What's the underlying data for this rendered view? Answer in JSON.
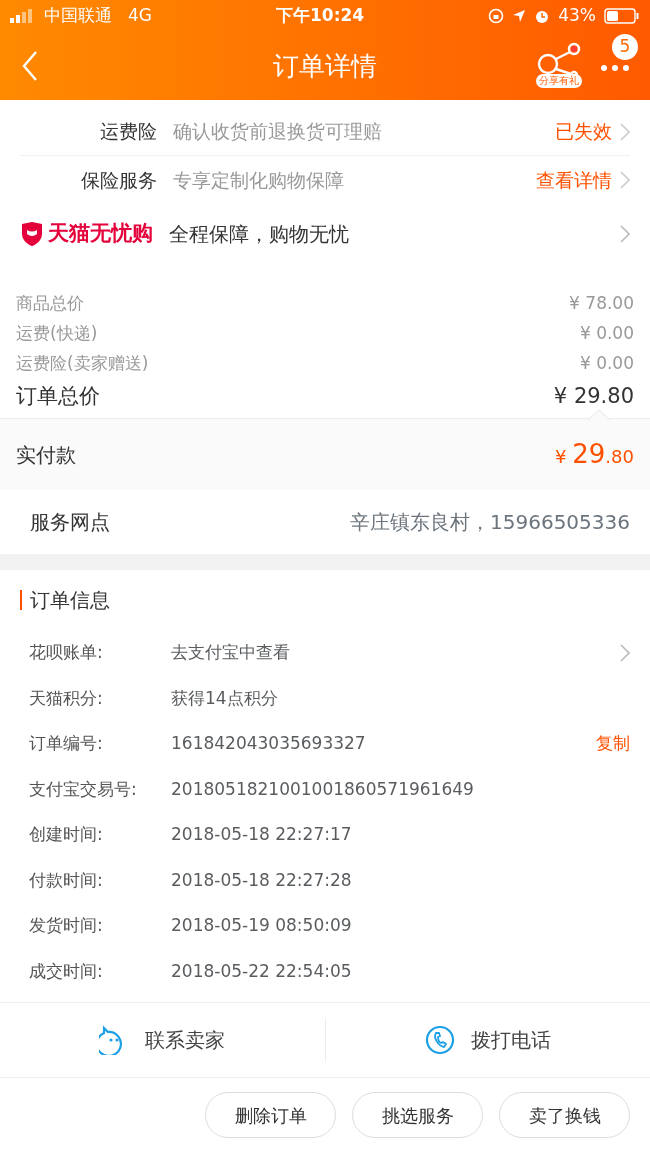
{
  "status_bar": {
    "carrier": "中国联通",
    "network": "4G",
    "time": "下午10:24",
    "battery": "43%"
  },
  "nav": {
    "title": "订单详情",
    "share_label": "分享有礼",
    "badge": "5"
  },
  "insurance_rows": [
    {
      "label": "运费险",
      "description": "确认收货前退换货可理赔",
      "action": "已失效"
    },
    {
      "label": "保险服务",
      "description": "专享定制化购物保障",
      "action": "查看详情"
    }
  ],
  "tmall_guarantee": {
    "brand": "天猫无忧购",
    "text": "全程保障，购物无忧"
  },
  "price_rows": [
    {
      "label": "商品总价",
      "value": "¥ 78.00",
      "kind": "minor"
    },
    {
      "label": "运费(快递)",
      "value": "¥ 0.00",
      "kind": "minor"
    },
    {
      "label": "运费险(卖家赠送)",
      "value": "¥ 0.00",
      "kind": "minor"
    },
    {
      "label": "订单总价",
      "value": "¥ 29.80",
      "kind": "total"
    }
  ],
  "paid": {
    "label": "实付款",
    "symbol": "¥",
    "integer": "29",
    "decimal": ".80"
  },
  "service_point": {
    "label": "服务网点",
    "value": "辛庄镇东良村，15966505336"
  },
  "order_info": {
    "title": "订单信息",
    "rows": [
      {
        "label": "花呗账单:",
        "value": "去支付宝中查看",
        "chevron": true
      },
      {
        "label": "天猫积分:",
        "value": "获得14点积分"
      },
      {
        "label": "订单编号:",
        "value": "161842043035693327",
        "action": "复制"
      },
      {
        "label": "支付宝交易号:",
        "value": "2018051821001001860571961649"
      },
      {
        "label": "创建时间:",
        "value": "2018-05-18 22:27:17"
      },
      {
        "label": "付款时间:",
        "value": "2018-05-18 22:27:28"
      },
      {
        "label": "发货时间:",
        "value": "2018-05-19 08:50:09"
      },
      {
        "label": "成交时间:",
        "value": "2018-05-22 22:54:05"
      }
    ]
  },
  "contact_bar": [
    {
      "label": "联系卖家",
      "kind": "chat"
    },
    {
      "label": "拨打电话",
      "kind": "phone"
    }
  ],
  "buttons": [
    "删除订单",
    "挑选服务",
    "卖了换钱"
  ]
}
